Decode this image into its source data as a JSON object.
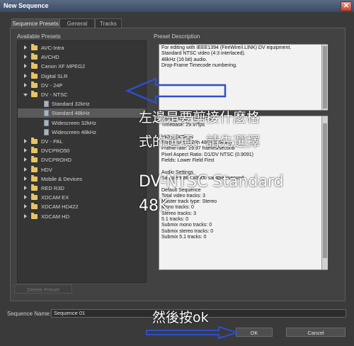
{
  "window": {
    "title": "New Sequence",
    "close_glyph": "✕"
  },
  "tabs": [
    "Sequence Presets",
    "General",
    "Tracks"
  ],
  "available_presets": {
    "label": "Available Presets",
    "items": [
      {
        "label": "AVC-Intra",
        "type": "folder",
        "expanded": false
      },
      {
        "label": "AVCHD",
        "type": "folder",
        "expanded": false
      },
      {
        "label": "Canon XF MPEG2",
        "type": "folder",
        "expanded": false
      },
      {
        "label": "Digital SLR",
        "type": "folder",
        "expanded": false
      },
      {
        "label": "DV - 24P",
        "type": "folder",
        "expanded": false
      },
      {
        "label": "DV - NTSC",
        "type": "folder",
        "expanded": true
      },
      {
        "label": "Standard 32kHz",
        "type": "preset"
      },
      {
        "label": "Standard 48kHz",
        "type": "preset",
        "selected": true
      },
      {
        "label": "Widescreen 32kHz",
        "type": "preset"
      },
      {
        "label": "Widescreen 48kHz",
        "type": "preset"
      },
      {
        "label": "DV - PAL",
        "type": "folder",
        "expanded": false
      },
      {
        "label": "DVCPRO50",
        "type": "folder",
        "expanded": false
      },
      {
        "label": "DVCPROHD",
        "type": "folder",
        "expanded": false
      },
      {
        "label": "HDV",
        "type": "folder",
        "expanded": false
      },
      {
        "label": "Mobile & Devices",
        "type": "folder",
        "expanded": false
      },
      {
        "label": "RED R3D",
        "type": "folder",
        "expanded": false
      },
      {
        "label": "XDCAM EX",
        "type": "folder",
        "expanded": false
      },
      {
        "label": "XDCAM HD422",
        "type": "folder",
        "expanded": false
      },
      {
        "label": "XDCAM HD",
        "type": "folder",
        "expanded": false
      }
    ],
    "delete_button": "Delete Preset"
  },
  "preset_description": {
    "label": "Preset Description",
    "top_lines": [
      "For editing with IEEE1394 (FireWire/i.LINK) DV equipment.",
      "Standard NTSC video (4:3 interlaced).",
      "48kHz (16 bit) audio.",
      "Drop-Frame Timecode numbering."
    ],
    "detail_lines": [
      "Editing Mode: DV NTSC",
      "Timebase: 29.97fps",
      "",
      "Video Settings",
      "Frame size: 720h 480v (0.9091)",
      "Frame rate: 29.97 frames/second",
      "Pixel Aspect Ratio: D1/DV NTSC (0.9091)",
      "Fields: Lower Field First",
      "",
      "Audio Settings",
      "Sample Rate: 48000 samples/second",
      "",
      "Default Sequence",
      "Total video tracks: 3",
      "Master track type: Stereo",
      "Mono tracks: 0",
      "Stereo tracks: 3",
      "5.1 tracks: 0",
      "Submix mono tracks: 0",
      "Submix stereo tracks: 0",
      "Submix 5.1 tracks: 0"
    ]
  },
  "sequence_name": {
    "label": "Sequence Name:",
    "value": "Sequence 01"
  },
  "buttons": {
    "ok": "OK",
    "cancel": "Cancel"
  },
  "annotations": {
    "right_text_lines": [
      "左邊是要剪接什麼格",
      "式的選項，請先選擇",
      "DV-NTSC Standard",
      "48K"
    ],
    "bottom_text": "然後按ok",
    "arrow_color": "#2f4fc8"
  }
}
